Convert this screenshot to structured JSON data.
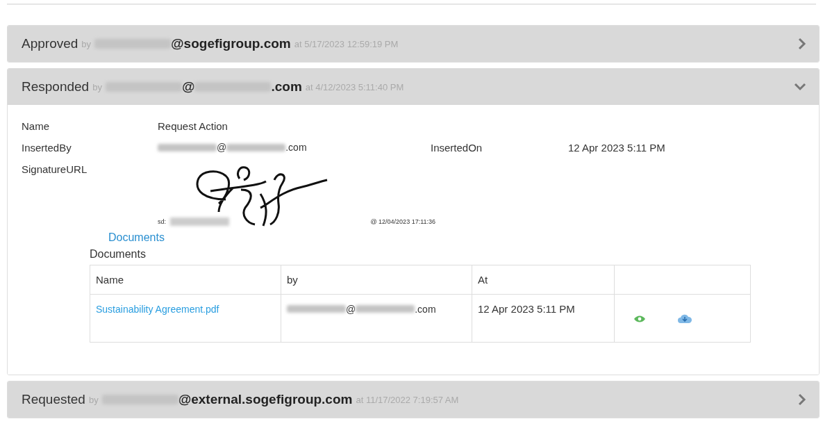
{
  "sections": [
    {
      "status": "Approved",
      "by": "by",
      "email": [
        {
          "kind": "redacted"
        },
        {
          "kind": "text",
          "text": "@sogefigroup.com"
        }
      ],
      "at": "at 5/17/2023 12:59:19 PM",
      "expanded": false
    },
    {
      "status": "Responded",
      "by": "by",
      "email": [
        {
          "kind": "redacted"
        },
        {
          "kind": "text",
          "text": "@"
        },
        {
          "kind": "redacted"
        },
        {
          "kind": "text",
          "text": ".com"
        }
      ],
      "at": "at 4/12/2023 5:11:40 PM",
      "expanded": true,
      "details": {
        "name_label": "Name",
        "name_value": "Request Action",
        "inserted_by_label": "InsertedBy",
        "inserted_by_value": [
          {
            "kind": "redacted"
          },
          {
            "kind": "text",
            "text": "@"
          },
          {
            "kind": "redacted"
          },
          {
            "kind": "text",
            "text": ".com"
          }
        ],
        "inserted_on_label": "InsertedOn",
        "inserted_on_value": "12 Apr 2023 5:11 PM",
        "signature_label": "SignatureURL",
        "signature": {
          "prefix": "sd:",
          "stamp": "@ 12/04/2023 17:11:36"
        },
        "documents_link": "Documents",
        "documents_title": "Documents",
        "table": {
          "columns": [
            "Name",
            "by",
            "At"
          ],
          "rows": [
            {
              "name": "Sustainability Agreement.pdf",
              "by": [
                {
                  "kind": "redacted"
                },
                {
                  "kind": "text",
                  "text": "@"
                },
                {
                  "kind": "redacted"
                },
                {
                  "kind": "text",
                  "text": ".com"
                }
              ],
              "at": "12 Apr 2023 5:11 PM"
            }
          ]
        }
      }
    },
    {
      "status": "Requested",
      "by": "by",
      "email": [
        {
          "kind": "redacted"
        },
        {
          "kind": "text",
          "text": "@external.sogefigroup.com"
        }
      ],
      "at": "at 11/17/2022 7:19:57 AM",
      "expanded": false
    }
  ]
}
